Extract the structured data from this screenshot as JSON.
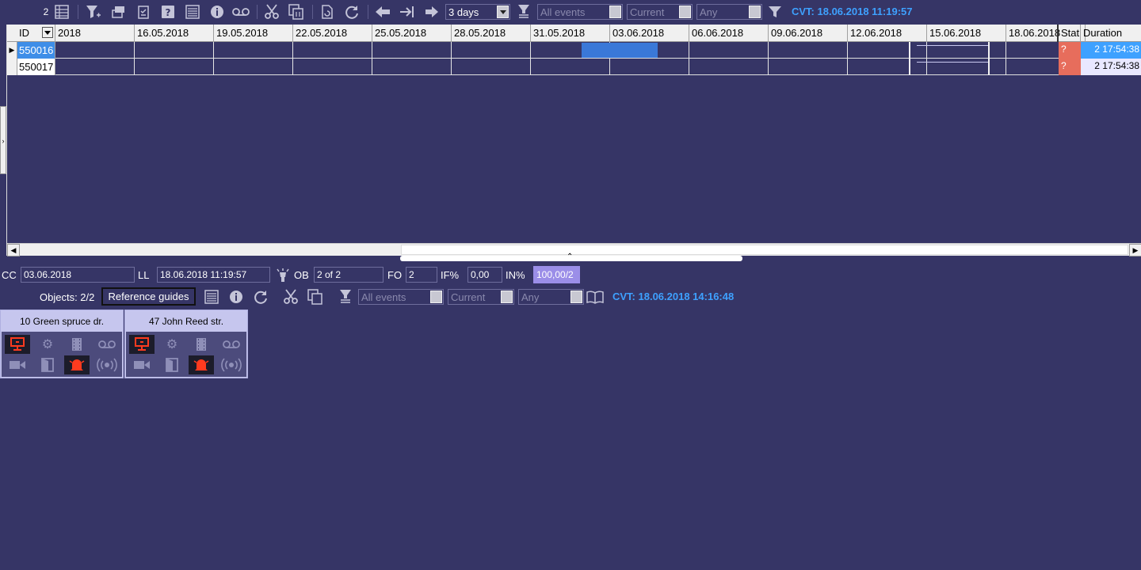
{
  "toolbar": {
    "count": "2",
    "period": "3 days",
    "filter_events": "All events",
    "filter_state": "Current",
    "filter_any": "Any",
    "cvt": "CVT: 18.06.2018 11:19:57"
  },
  "grid": {
    "columns": {
      "id": "ID",
      "stat": "Stat",
      "duration": "Duration"
    },
    "dates": [
      "2018",
      "16.05.2018",
      "19.05.2018",
      "22.05.2018",
      "25.05.2018",
      "28.05.2018",
      "31.05.2018",
      "03.06.2018",
      "06.06.2018",
      "09.06.2018",
      "12.06.2018",
      "15.06.2018",
      "18.06.2018"
    ],
    "rows": [
      {
        "id": "550016",
        "stat": "?",
        "duration": "2 17:54:38"
      },
      {
        "id": "550017",
        "stat": "?",
        "duration": "2 17:54:38"
      }
    ]
  },
  "status": {
    "cc_label": "CC",
    "cc_value": "03.06.2018",
    "ll_label": "LL",
    "ll_value": "18.06.2018 11:19:57",
    "ob_label": "OB",
    "ob_value": "2 of 2",
    "fo_label": "FO",
    "fo_value": "2",
    "if_label": "IF%",
    "if_value": "0,00",
    "in_label": "IN%",
    "in_value": "100,00/2"
  },
  "objects_bar": {
    "objects_label": "Objects: 2/2",
    "ref_guides": "Reference guides",
    "filter_events": "All events",
    "filter_state": "Current",
    "filter_any": "Any",
    "cvt": "CVT: 18.06.2018 14:16:48"
  },
  "cards": [
    {
      "title": "10 Green spruce dr."
    },
    {
      "title": "47 John Reed str."
    }
  ],
  "colors": {
    "background": "#363566",
    "accent": "#3ea1ff",
    "alarm": "#ff3b1f",
    "stat": "#e76d5c"
  }
}
